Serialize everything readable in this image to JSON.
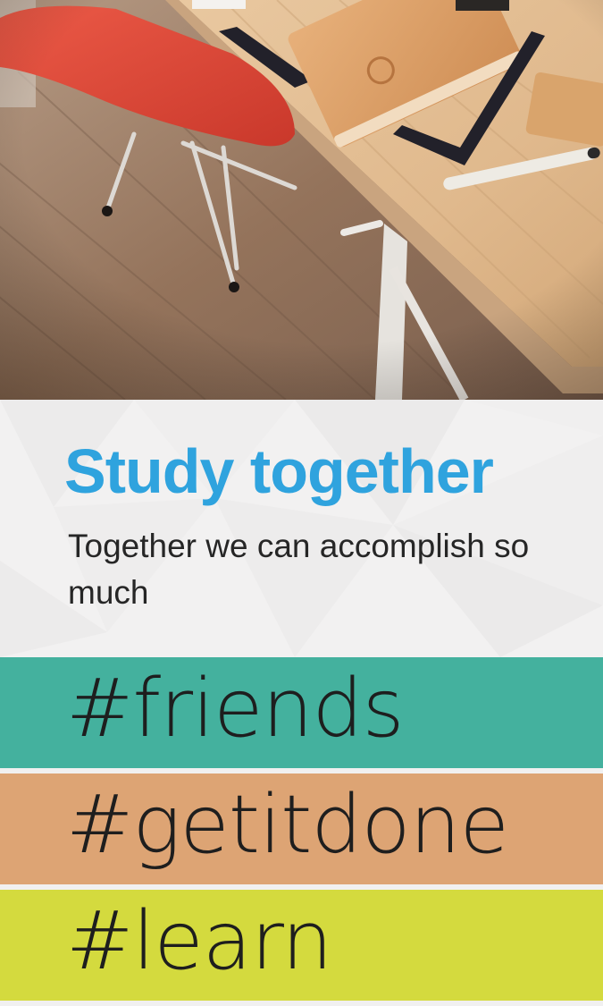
{
  "headline": {
    "title": "Study together",
    "subtitle": "Together we can accomplish so much"
  },
  "colors": {
    "title": "#2fa3de",
    "bar_friends": "#44b19e",
    "bar_getitdone": "#dda474",
    "bar_learn": "#d4da3e",
    "background": "#f1f0f0"
  },
  "hashtags": [
    {
      "label": "#friends"
    },
    {
      "label": "#getitdone"
    },
    {
      "label": "#learn"
    }
  ],
  "photo": {
    "icon": "desk-photo"
  }
}
